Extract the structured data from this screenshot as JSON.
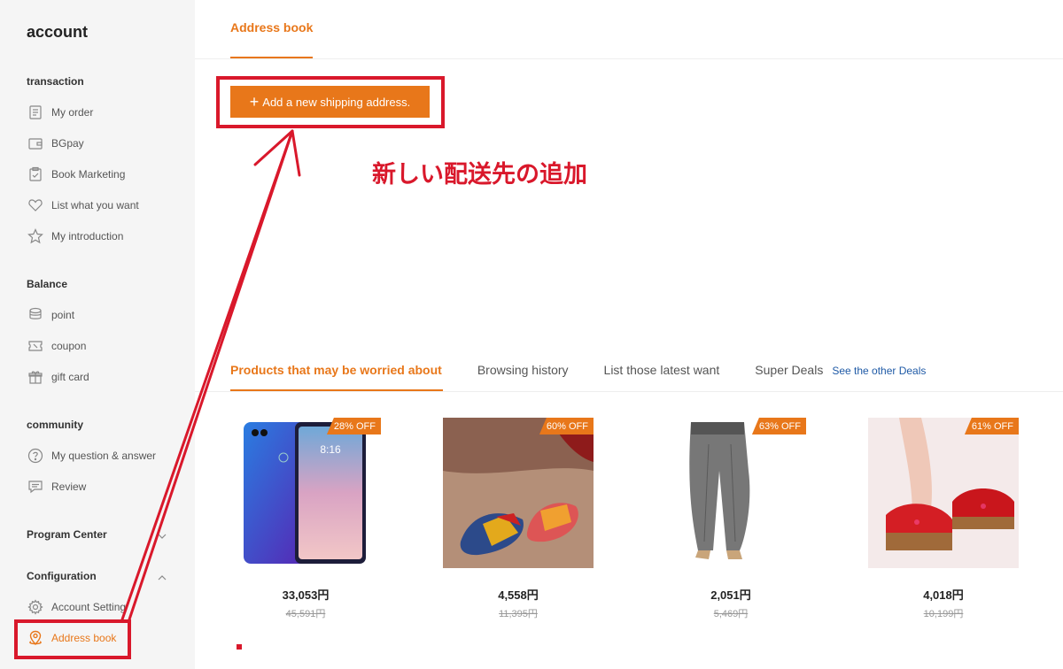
{
  "sidebar": {
    "title": "account",
    "sections": {
      "transaction": "transaction",
      "balance": "Balance",
      "community": "community",
      "program_center": "Program Center",
      "configuration": "Configuration"
    },
    "items": {
      "my_order": "My order",
      "bgpay": "BGpay",
      "book_marketing": "Book Marketing",
      "list_want": "List what you want",
      "my_intro": "My introduction",
      "point": "point",
      "coupon": "coupon",
      "gift_card": "gift card",
      "qa": "My question & answer",
      "review": "Review",
      "account_setting": "Account Setting",
      "address_book": "Address book"
    }
  },
  "main": {
    "tab_title": "Address book",
    "add_button": "Add a new shipping address.",
    "annotation": "新しい配送先の追加"
  },
  "recommend": {
    "tabs": [
      "Products that may be worried about",
      "Browsing history",
      "List those latest want",
      "Super Deals"
    ],
    "see_other": "See the other Deals",
    "products": [
      {
        "badge": "28% OFF",
        "price": "33,053円",
        "orig": "45,591円"
      },
      {
        "badge": "60% OFF",
        "price": "4,558円",
        "orig": "11,395円"
      },
      {
        "badge": "63% OFF",
        "price": "2,051円",
        "orig": "5,469円"
      },
      {
        "badge": "61% OFF",
        "price": "4,018円",
        "orig": "10,199円"
      }
    ]
  },
  "colors": {
    "accent": "#e8771a",
    "annotation": "#d9182b",
    "link": "#1f5aa6"
  }
}
